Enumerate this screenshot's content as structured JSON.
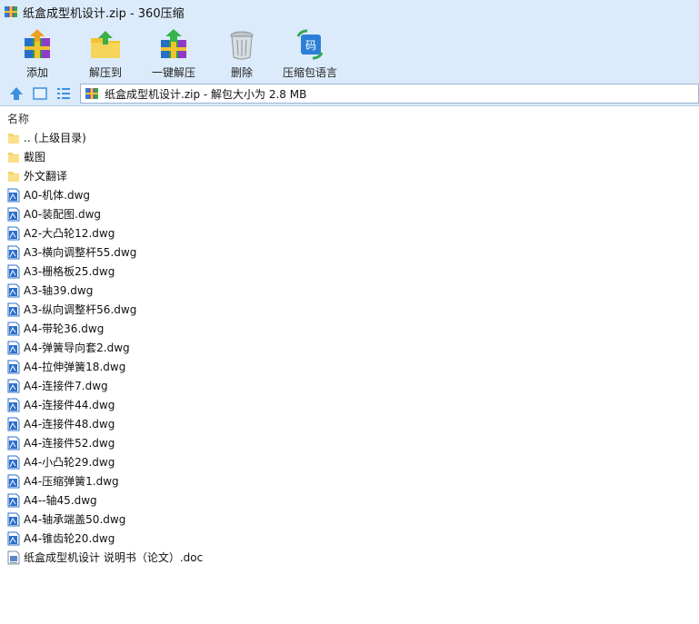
{
  "window": {
    "title": "纸盒成型机设计.zip - 360压缩"
  },
  "toolbar": {
    "buttons": [
      {
        "label": "添加",
        "icon": "add-archive-icon"
      },
      {
        "label": "解压到",
        "icon": "extract-to-icon"
      },
      {
        "label": "一键解压",
        "icon": "one-click-extract-icon"
      },
      {
        "label": "删除",
        "icon": "trash-icon"
      },
      {
        "label": "压缩包语言",
        "icon": "archive-language-icon"
      }
    ]
  },
  "address": {
    "path": "纸盒成型机设计.zip - 解包大小为 2.8 MB"
  },
  "list": {
    "header": "名称",
    "items": [
      {
        "name": ".. (上级目录)",
        "type": "folder"
      },
      {
        "name": "截图",
        "type": "folder"
      },
      {
        "name": "外文翻译",
        "type": "folder"
      },
      {
        "name": "A0-机体.dwg",
        "type": "dwg"
      },
      {
        "name": "A0-装配图.dwg",
        "type": "dwg"
      },
      {
        "name": "A2-大凸轮12.dwg",
        "type": "dwg"
      },
      {
        "name": "A3-横向调整杆55.dwg",
        "type": "dwg"
      },
      {
        "name": "A3-栅格板25.dwg",
        "type": "dwg"
      },
      {
        "name": "A3-轴39.dwg",
        "type": "dwg"
      },
      {
        "name": "A3-纵向调整杆56.dwg",
        "type": "dwg"
      },
      {
        "name": "A4-带轮36.dwg",
        "type": "dwg"
      },
      {
        "name": "A4-弹簧导向套2.dwg",
        "type": "dwg"
      },
      {
        "name": "A4-拉伸弹簧18.dwg",
        "type": "dwg"
      },
      {
        "name": "A4-连接件7.dwg",
        "type": "dwg"
      },
      {
        "name": "A4-连接件44.dwg",
        "type": "dwg"
      },
      {
        "name": "A4-连接件48.dwg",
        "type": "dwg"
      },
      {
        "name": "A4-连接件52.dwg",
        "type": "dwg"
      },
      {
        "name": "A4-小凸轮29.dwg",
        "type": "dwg"
      },
      {
        "name": "A4-压缩弹簧1.dwg",
        "type": "dwg"
      },
      {
        "name": "A4--轴45.dwg",
        "type": "dwg"
      },
      {
        "name": "A4-轴承端盖50.dwg",
        "type": "dwg"
      },
      {
        "name": "A4-锥齿轮20.dwg",
        "type": "dwg"
      },
      {
        "name": "纸盒成型机设计 说明书（论文）.doc",
        "type": "doc"
      }
    ]
  }
}
